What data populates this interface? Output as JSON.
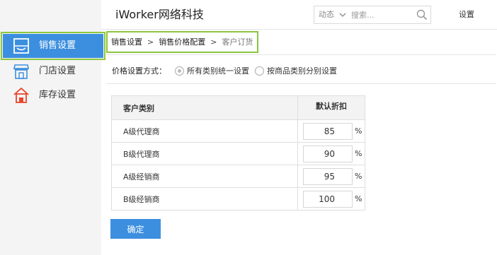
{
  "header": {
    "brand": "iWorker网络科技",
    "filter_label": "动态",
    "search_placeholder": "搜索...",
    "settings_label": "设置"
  },
  "sidebar": {
    "items": [
      {
        "label": "销售设置",
        "icon": "sales-icon",
        "active": true
      },
      {
        "label": "门店设置",
        "icon": "store-icon",
        "active": false
      },
      {
        "label": "库存设置",
        "icon": "warehouse-icon",
        "active": false
      }
    ]
  },
  "breadcrumb": {
    "items": [
      "销售设置",
      "销售价格配置",
      "客户订货"
    ],
    "separator": ">"
  },
  "price_mode": {
    "label": "价格设置方式：",
    "options": [
      {
        "label": "所有类别统一设置",
        "selected": true
      },
      {
        "label": "按商品类别分别设置",
        "selected": false
      }
    ]
  },
  "table": {
    "headers": [
      "客户类别",
      "默认折扣"
    ],
    "rows": [
      {
        "category": "A级代理商",
        "discount": "85",
        "unit": "%"
      },
      {
        "category": "B级代理商",
        "discount": "90",
        "unit": "%"
      },
      {
        "category": "A级经销商",
        "discount": "95",
        "unit": "%"
      },
      {
        "category": "B级经销商",
        "discount": "100",
        "unit": "%"
      }
    ]
  },
  "confirm_label": "确定",
  "colors": {
    "primary": "#3c8fdf",
    "highlight": "#8cc63f",
    "store_icon": "#3c8fdf",
    "warehouse_icon": "#e8462b"
  }
}
